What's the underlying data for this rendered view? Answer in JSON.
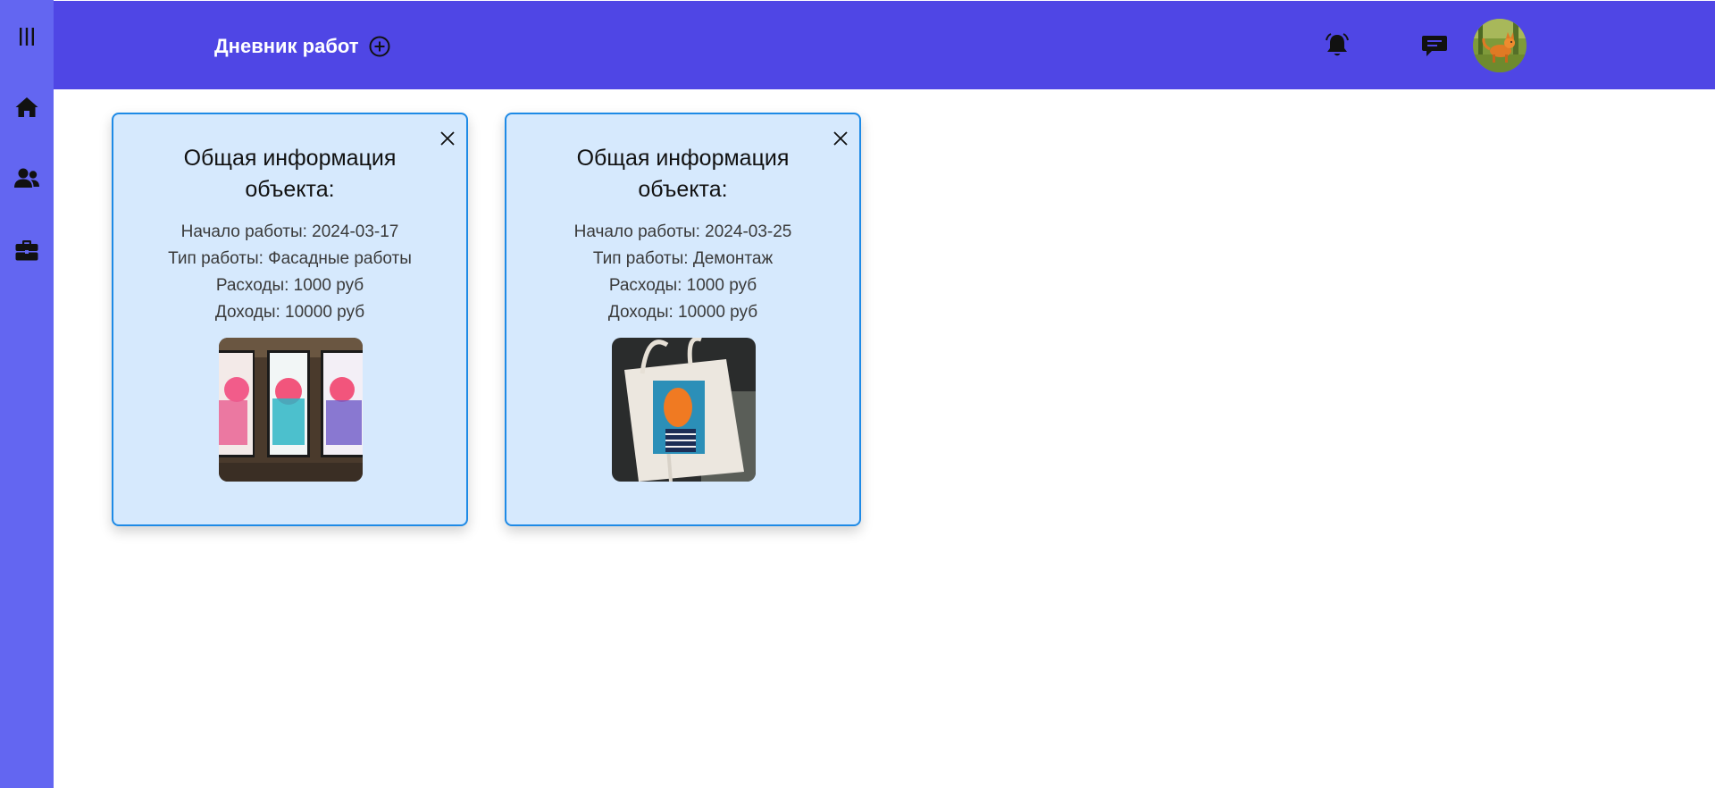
{
  "header": {
    "title": "Дневник работ",
    "add_icon": "plus-circle-icon",
    "notifications_icon": "bell-icon",
    "messages_icon": "chat-icon",
    "avatar": "user-avatar"
  },
  "sidebar": {
    "items": [
      {
        "icon": "menu-bars-icon"
      },
      {
        "icon": "home-icon"
      },
      {
        "icon": "users-icon"
      },
      {
        "icon": "briefcase-icon"
      }
    ]
  },
  "colors": {
    "sidebar": "#6366f1",
    "topbar": "#4f46e5",
    "card_bg": "#d6e9fd",
    "card_border": "#1e8ae6"
  },
  "cards": [
    {
      "title": "Общая информация объекта:",
      "start": "Начало работы: 2024-03-17",
      "type": "Тип работы: Фасадные работы",
      "expenses": "Расходы: 1000 руб",
      "income": "Доходы: 10000 руб",
      "photo": "posters-photo"
    },
    {
      "title": "Общая информация объекта:",
      "start": "Начало работы: 2024-03-25",
      "type": "Тип работы: Демонтаж",
      "expenses": "Расходы: 1000 руб",
      "income": "Доходы: 10000 руб",
      "photo": "tote-bag-photo"
    }
  ]
}
